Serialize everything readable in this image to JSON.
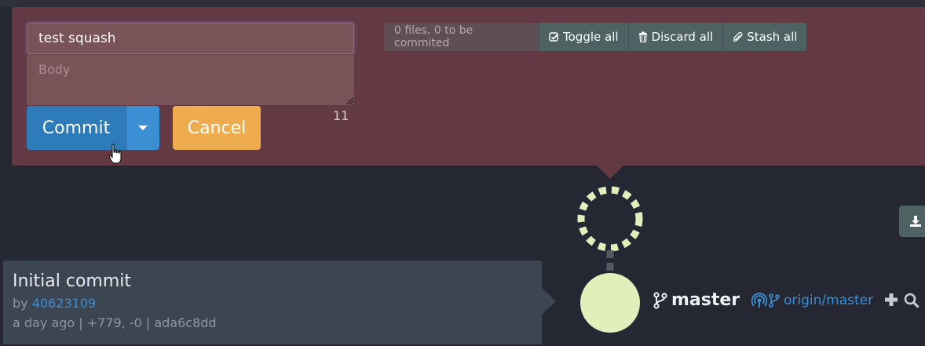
{
  "commit_form": {
    "title_value": "test squash",
    "body_placeholder": "Body",
    "char_count": "11",
    "commit_label": "Commit",
    "cancel_label": "Cancel"
  },
  "staging_toolbar": {
    "file_status": "0 files, 0 to be commited",
    "toggle_all_label": "Toggle all",
    "discard_all_label": "Discard all",
    "stash_all_label": "Stash all"
  },
  "commit": {
    "title": "Initial commit",
    "by_label": "by",
    "author": "40623109",
    "meta_line": "a day ago | +779, -0 | ada6c8dd"
  },
  "refs": {
    "local_branch": "master",
    "remote_branch": "origin/master"
  },
  "colors": {
    "panel_bg": "#633a43",
    "commit_button": "#2e7bb9",
    "cancel_button": "#efac4e",
    "node": "#e2efbb",
    "link": "#3c8fd6",
    "background": "#252833"
  },
  "icons": [
    "check-icon",
    "trash-icon",
    "paperclip-icon",
    "caret-down-icon",
    "branch-icon",
    "remote-icon",
    "plus-icon",
    "search-icon",
    "download-icon",
    "hand-cursor-icon"
  ]
}
